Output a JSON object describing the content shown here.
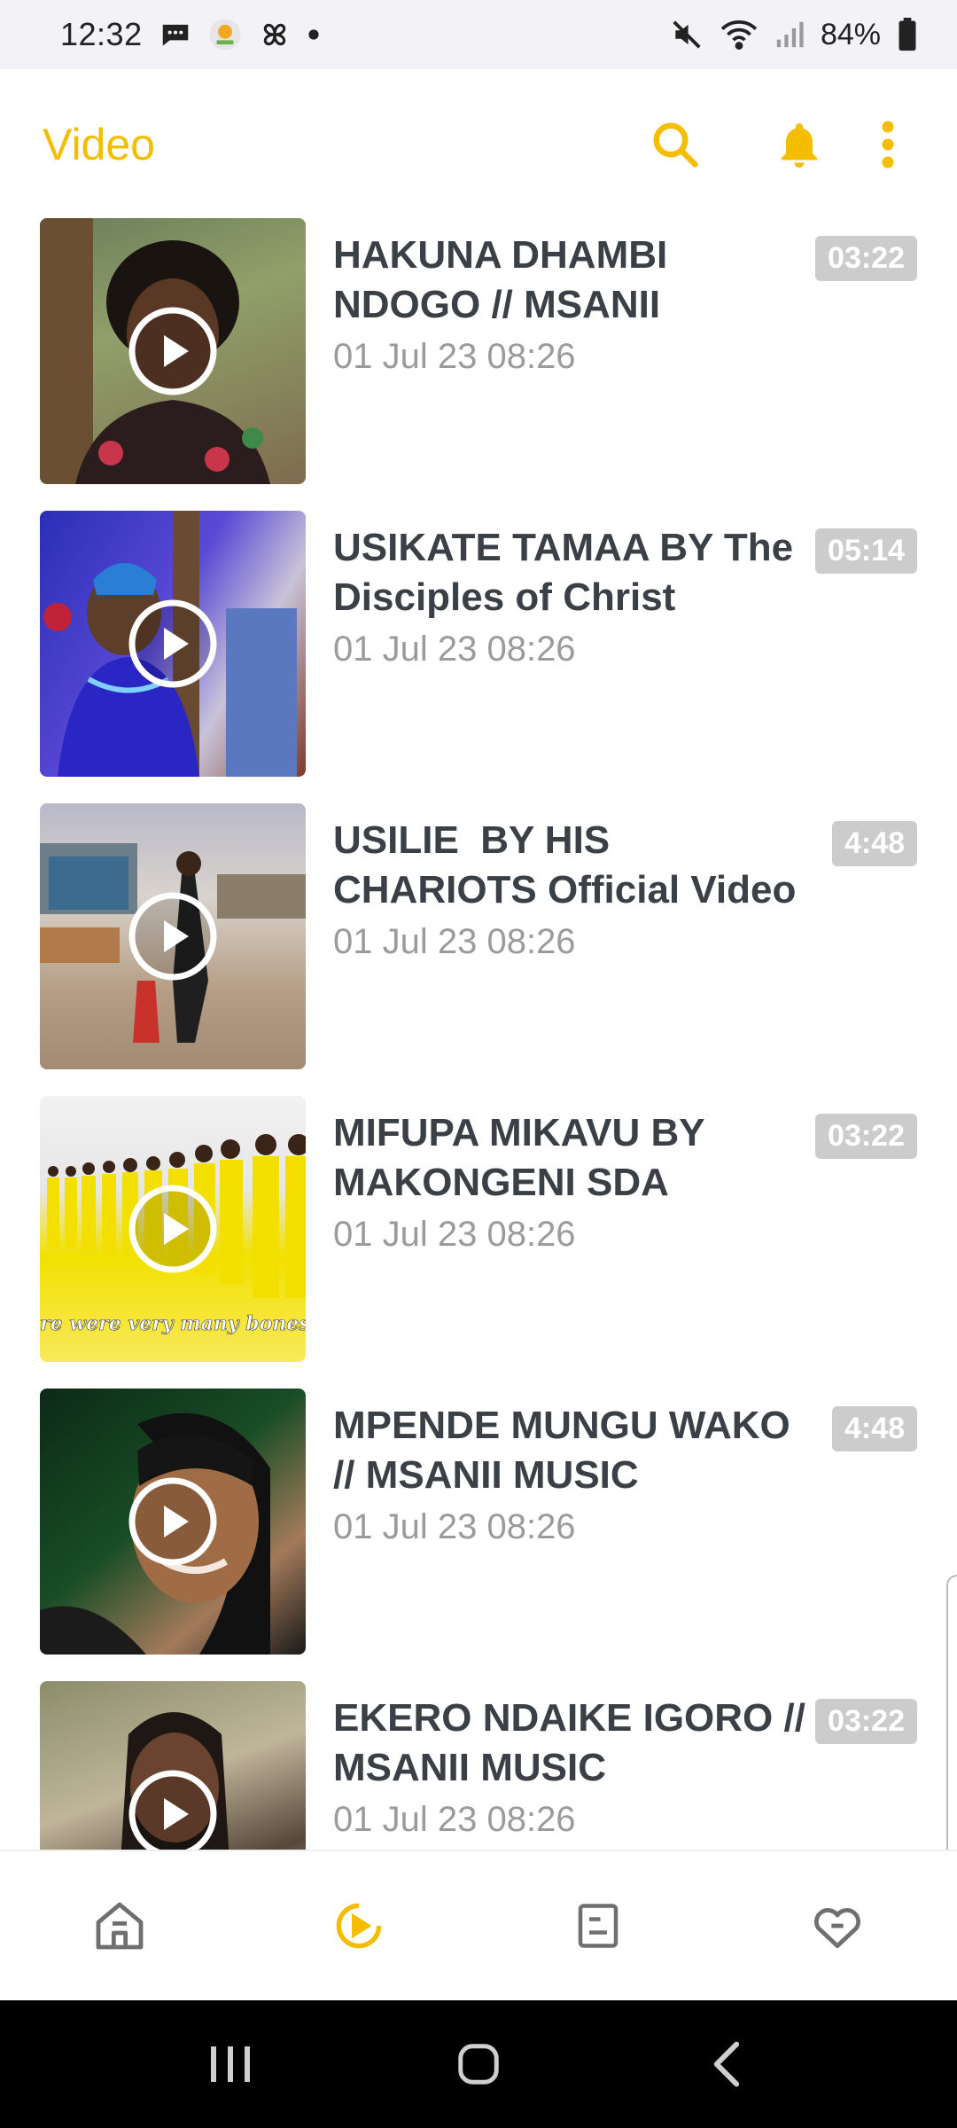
{
  "status_bar": {
    "time": "12:32",
    "battery_percent": "84%",
    "icons_left": [
      "chat-bubble-icon",
      "app-logo-icon",
      "pinwheel-icon",
      "dot-icon"
    ],
    "icons_right": [
      "mute-icon",
      "wifi-icon",
      "signal-icon",
      "battery-icon"
    ]
  },
  "header": {
    "title": "Video",
    "accent_color": "#f5bd00",
    "actions": [
      "search-icon",
      "bell-icon",
      "more-vert-icon"
    ]
  },
  "videos": [
    {
      "title": "HAKUNA DHAMBI NDOGO // MSANII",
      "date": "01 Jul 23 08:26",
      "duration": "03:22"
    },
    {
      "title": "USIKATE TAMAA BY The Disciples of Christ",
      "date": "01 Jul 23 08:26",
      "duration": "05:14"
    },
    {
      "title": "USILIE  BY HIS CHARIOTS Official Video",
      "date": "01 Jul 23 08:26",
      "duration": "4:48"
    },
    {
      "title": "MIFUPA MIKAVU BY MAKONGENI SDA",
      "date": "01 Jul 23 08:26",
      "duration": "03:22",
      "thumb_caption": "re were very many bones"
    },
    {
      "title": "MPENDE MUNGU WAKO // MSANII MUSIC",
      "date": "01 Jul 23 08:26",
      "duration": "4:48"
    },
    {
      "title": "EKERO NDAIKE IGORO // MSANII MUSIC",
      "date": "01 Jul 23 08:26",
      "duration": "03:22"
    }
  ],
  "bottom_nav": {
    "items": [
      "home-icon",
      "video-play-icon",
      "news-icon",
      "favorites-heart-icon"
    ],
    "active": "video-play-icon",
    "active_color": "#f5bd00",
    "inactive_color": "#6f6f6f"
  },
  "system_nav": [
    "recents-icon",
    "home-circle-icon",
    "back-icon"
  ]
}
